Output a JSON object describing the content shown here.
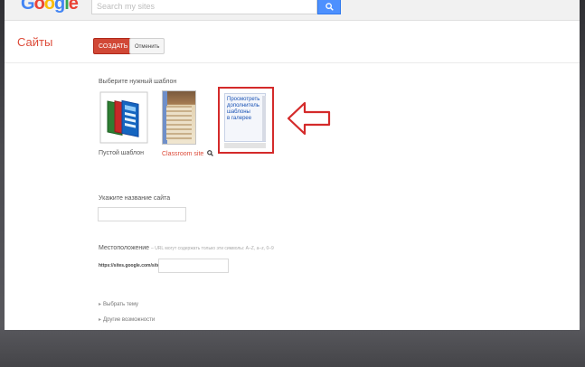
{
  "app": {
    "logo_text": "Google",
    "logo_letters": [
      "G",
      "o",
      "o",
      "g",
      "l",
      "e"
    ],
    "search_placeholder": "Search my sites",
    "title": "Сайты"
  },
  "toolbar": {
    "create_label": "СОЗДАТЬ",
    "cancel_label": "Отменить"
  },
  "template_section": {
    "heading": "Выберите нужный шаблон",
    "templates": [
      {
        "name": "Пустой шаблон",
        "icon": "blank-template-icon"
      },
      {
        "name": "Classroom site",
        "icon": "classroom-template-icon"
      },
      {
        "name": "Просмотреть дополнитель шаблоны в галерее",
        "lines": [
          "Просмотреть",
          "дополнитель",
          "шаблоны",
          "в галерее"
        ],
        "icon": "gallery-template-icon"
      }
    ],
    "highlight_color": "#d42a2a"
  },
  "site_name": {
    "label": "Укажите название сайта",
    "value": ""
  },
  "location": {
    "label": "Местоположение",
    "hint": "– URL могут содержать только эти символы: A–Z, a–z, 0–9",
    "prefix": "https://sites.google.com/site/",
    "value": ""
  },
  "more": {
    "theme": "Выбрать тему",
    "other": "Другие возможности"
  },
  "colors": {
    "accent": "#dd4b39",
    "create_button": "#d14836",
    "search_button": "#4d90fe",
    "link": "#1a53b5"
  }
}
